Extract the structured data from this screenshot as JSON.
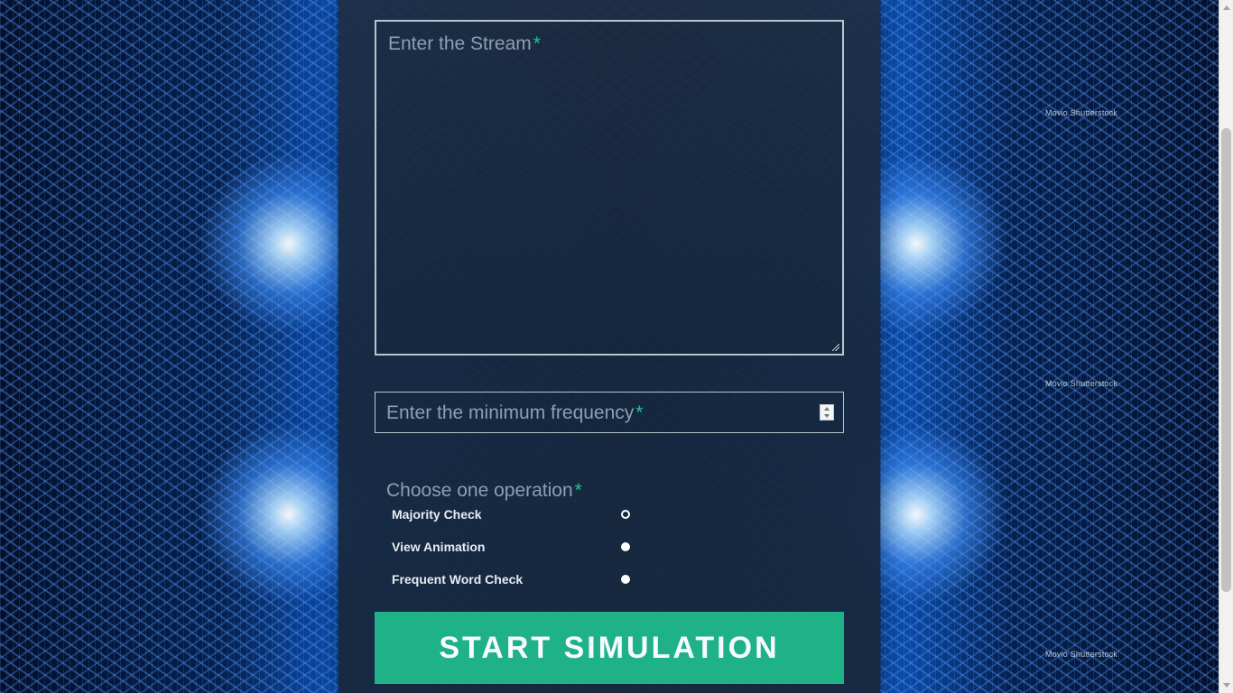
{
  "background": {
    "watermark_text": "Movio Shutterstock"
  },
  "form": {
    "stream_label": "Enter the Stream",
    "min_frequency_label": "Enter the minimum frequency",
    "required_marker": "*",
    "operation_label": "Choose one operation",
    "operations": [
      {
        "label": "Majority Check",
        "selected": true
      },
      {
        "label": "View Animation",
        "selected": false
      },
      {
        "label": "Frequent Word Check",
        "selected": false
      }
    ],
    "submit_label": "START SIMULATION"
  },
  "colors": {
    "accent": "#1eb286",
    "required": "#26c28d",
    "panel": "#1d2f47",
    "border": "#b8c6cb"
  },
  "icons": {
    "resize": "resize-handle-icon",
    "stepper_up": "chevron-up-icon",
    "stepper_down": "chevron-down-icon",
    "scroll_up": "scroll-up-icon",
    "scroll_down": "scroll-down-icon"
  }
}
